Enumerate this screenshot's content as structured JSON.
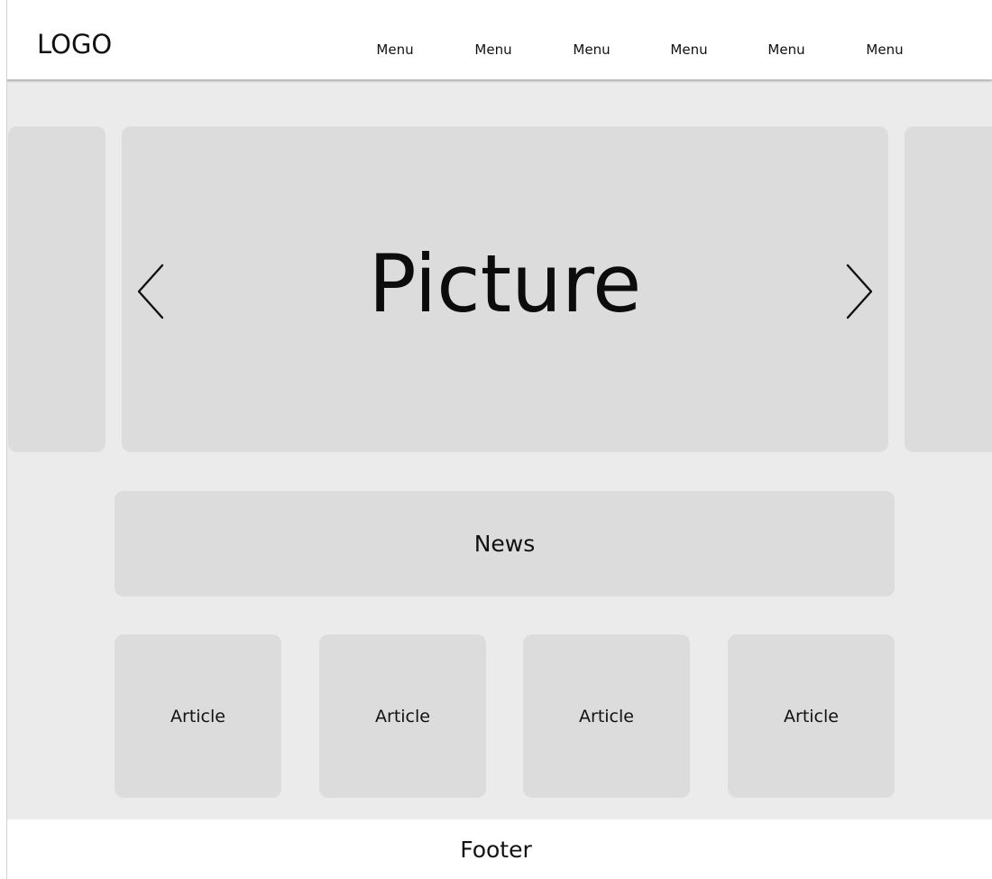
{
  "header": {
    "logo": "LOGO",
    "menu": [
      "Menu",
      "Menu",
      "Menu",
      "Menu",
      "Menu",
      "Menu"
    ]
  },
  "carousel": {
    "main_label": "Picture",
    "prev_icon": "chevron-left-icon",
    "next_icon": "chevron-right-icon"
  },
  "news": {
    "label": "News"
  },
  "articles": [
    "Article",
    "Article",
    "Article",
    "Article"
  ],
  "footer": {
    "label": "Footer"
  },
  "colors": {
    "page_background": "#ebebeb",
    "panel": "#dcdcdc",
    "header_footer": "#ffffff",
    "text": "#111111"
  }
}
